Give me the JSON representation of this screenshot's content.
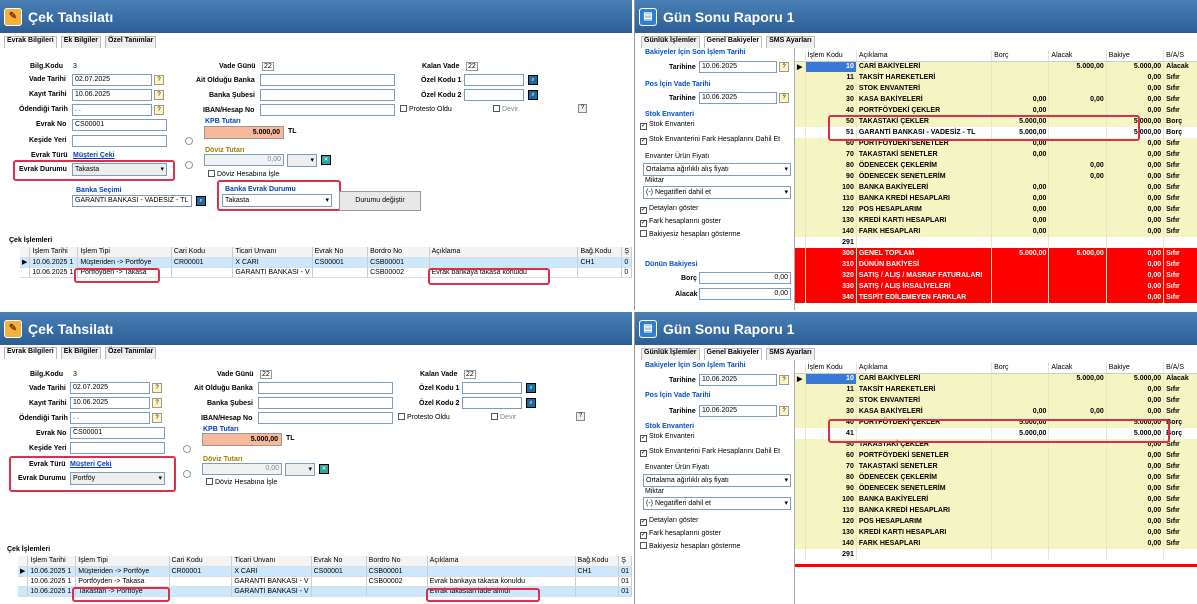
{
  "cek": {
    "title": "Çek Tahsilatı",
    "tabs": [
      "Evrak Bilgileri",
      "Ek Bilgiler",
      "Özel Tanımlar"
    ],
    "labels": {
      "bilg_kodu": "Bilg.Kodu",
      "vade_tarihi": "Vade Tarihi",
      "kayit_tarihi": "Kayıt Tarihi",
      "odendigi_tarih": "Ödendiği Tarih",
      "evrak_no": "Evrak No",
      "keside_yeri": "Keşide Yeri",
      "evrak_turu": "Evrak Türü",
      "evrak_durumu": "Evrak Durumu",
      "vade_gunu": "Vade Günü",
      "ait_oldugu_banka": "Ait Olduğu Banka",
      "banka_subesi": "Banka Şubesi",
      "iban": "IBAN/Hesap No",
      "kalan_vade": "Kalan Vade",
      "ozel_kodu_1": "Özel Kodu 1",
      "ozel_kodu_2": "Özel Kodu 2",
      "protesto": "Protesto Oldu",
      "devir": "Devir",
      "kpb_tutari": "KPB Tutarı",
      "doviz_tutari": "Döviz Tutarı",
      "doviz_hesabina": "Döviz Hesabına İşle",
      "banka_secimi": "Banka Seçimi",
      "banka_evrak_durumu": "Banka Evrak Durumu",
      "durumu_degistir": "Durumu değiştir",
      "cek_islemleri": "Çek İşlemleri",
      "tl": "TL",
      "q": "?",
      "badge": "22",
      "bilg_val": "3"
    },
    "values": {
      "vade_tarihi": "02.07.2025",
      "kayit_tarihi": "10.06.2025",
      "odendigi_tarih": " .  .",
      "evrak_no": "CS00001",
      "evrak_turu": "Müşteri Çeki",
      "kpb_tutari": "5.000,00",
      "doviz_tutari": "0,00",
      "banka": "GARANTİ BANKASI - VADESİZ - TL"
    },
    "top": {
      "evrak_durumu": "Takasta",
      "banka_evrak_durumu": "Takasta"
    },
    "bottom": {
      "evrak_durumu": "Portföy"
    },
    "grid_headers": [
      "İşlem Tarihi",
      "İşlem Tipi",
      "Cari Kodu",
      "Ticari Unvanı",
      "Evrak No",
      "Bordro No",
      "Açıklama",
      "Bağ.Kodu",
      "Ş"
    ],
    "top_rows": [
      [
        "10.06.2025 1",
        "Müşteriden -> Portföye",
        "CR00001",
        "X CARİ",
        "CS00001",
        "CSB00001",
        "",
        "CH1",
        "0"
      ],
      [
        "10.06.2025 1",
        "Portföyden -> Takasa",
        "",
        "GARANTİ BANKASI - V",
        "",
        "CSB00002",
        "Evrak bankaya takasa konuldu",
        "",
        "0"
      ]
    ],
    "bottom_rows": [
      [
        "10.06.2025 1",
        "Müşteriden -> Portföye",
        "CR00001",
        "X CARİ",
        "CS00001",
        "CSB00001",
        "",
        "CH1",
        "01"
      ],
      [
        "10.06.2025 1",
        "Portföyden -> Takasa",
        "",
        "GARANTİ BANKASI - V",
        "",
        "CSB00002",
        "Evrak bankaya takasa konuldu",
        "",
        "01"
      ],
      [
        "10.06.2025 1",
        "Takastan -> Portföye",
        "",
        "GARANTİ BANKASI - V",
        "",
        "",
        "Evrak takastan iade alındı",
        "",
        "01"
      ]
    ]
  },
  "gun": {
    "title": "Gün Sonu Raporu 1",
    "tabs": [
      "Günlük İşlemler",
      "Genel Bakiyeler",
      "SMS Ayarları"
    ],
    "left": {
      "bakiye_title": "Bakiyeler İçin Son İşlem Tarihi",
      "tarihine": "Tarihine",
      "tarih": "10.06.2025",
      "pos_title": "Pos İçin Vade Tarihi",
      "pos_tarih": "10.06.2025",
      "stok_title": "Stok Envanteri",
      "stok_envanteri": "Stok Envanteri",
      "stok_fark": "Stok Envanterini Fark Hesaplarını Dahil Et",
      "envanter_fiyat": "Envanter Ürün Fiyatı",
      "envanter_val": "Ortalama ağırlıklı alış fiyatı",
      "miktar": "Miktar",
      "miktar_val": "(-) Negatifleri dahil et",
      "detay": "Detayları göster",
      "fark": "Fark hesaplarını göster",
      "bakiyesiz": "Bakiyesiz hesapları gösterme",
      "dunun": "Dünün Bakiyesi",
      "borc": "Borç",
      "alacak": "Alacak",
      "zero": "0,00"
    },
    "headers": [
      "İşlem Kodu",
      "Açıklama",
      "Borç",
      "Alacak",
      "Bakiye",
      "B/A/S"
    ],
    "top_rows": [
      [
        "10",
        "CARİ BAKİYELERİ",
        "",
        "5.000,00",
        "5.000,00",
        "Alacak",
        "y"
      ],
      [
        "11",
        "TAKSİT HAREKETLERİ",
        "",
        "",
        "0,00",
        "Sıfır",
        "y"
      ],
      [
        "20",
        "STOK ENVANTERİ",
        "",
        "",
        "0,00",
        "Sıfır",
        "y"
      ],
      [
        "30",
        "KASA BAKİYELERİ",
        "0,00",
        "0,00",
        "0,00",
        "Sıfır",
        "y"
      ],
      [
        "40",
        "PORTFÖYDEKİ ÇEKLER",
        "0,00",
        "",
        "0,00",
        "Sıfır",
        "y"
      ],
      [
        "50",
        "TAKASTAKİ ÇEKLER",
        "5.000,00",
        "",
        "5.000,00",
        "Borç",
        "y"
      ],
      [
        "51",
        "GARANTİ BANKASI - VADESİZ - TL",
        "5.000,00",
        "",
        "5.000,00",
        "Borç",
        "w"
      ],
      [
        "60",
        "PORTFÖYDEKİ SENETLER",
        "0,00",
        "",
        "0,00",
        "Sıfır",
        "y"
      ],
      [
        "70",
        "TAKASTAKİ SENETLER",
        "0,00",
        "",
        "0,00",
        "Sıfır",
        "y"
      ],
      [
        "80",
        "ÖDENECEK ÇEKLERİM",
        "",
        "0,00",
        "0,00",
        "Sıfır",
        "y"
      ],
      [
        "90",
        "ÖDENECEK SENETLERİM",
        "",
        "0,00",
        "0,00",
        "Sıfır",
        "y"
      ],
      [
        "100",
        "BANKA BAKİYELERİ",
        "0,00",
        "",
        "0,00",
        "Sıfır",
        "y"
      ],
      [
        "110",
        "BANKA KREDİ HESAPLARI",
        "0,00",
        "",
        "0,00",
        "Sıfır",
        "y"
      ],
      [
        "120",
        "POS HESAPLARIM",
        "0,00",
        "",
        "0,00",
        "Sıfır",
        "y"
      ],
      [
        "130",
        "KREDİ KARTI HESAPLARI",
        "0,00",
        "",
        "0,00",
        "Sıfır",
        "y"
      ],
      [
        "140",
        "FARK HESAPLARI",
        "0,00",
        "",
        "0,00",
        "Sıfır",
        "y"
      ],
      [
        "291",
        "",
        "",
        "",
        "",
        "",
        "w"
      ],
      [
        "300",
        "GENEL TOPLAM",
        "5.000,00",
        "5.000,00",
        "0,00",
        "Sıfır",
        "r"
      ],
      [
        "310",
        "DÜNÜN BAKİYESİ",
        "",
        "",
        "0,00",
        "Sıfır",
        "r"
      ],
      [
        "320",
        "SATIŞ / ALIŞ / MASRAF FATURALARI",
        "",
        "",
        "0,00",
        "Sıfır",
        "r"
      ],
      [
        "330",
        "SATIŞ / ALIŞ İRSALİYELERİ",
        "",
        "",
        "0,00",
        "Sıfır",
        "r"
      ],
      [
        "340",
        "TESPİT EDİLEMEYEN FARKLAR",
        "",
        "",
        "0,00",
        "Sıfır",
        "r"
      ]
    ],
    "bottom_rows": [
      [
        "10",
        "CARİ BAKİYELERİ",
        "",
        "5.000,00",
        "5.000,00",
        "Alacak",
        "y"
      ],
      [
        "11",
        "TAKSİT HAREKETLERİ",
        "",
        "",
        "0,00",
        "Sıfır",
        "y"
      ],
      [
        "20",
        "STOK ENVANTERİ",
        "",
        "",
        "0,00",
        "Sıfır",
        "y"
      ],
      [
        "30",
        "KASA BAKİYELERİ",
        "0,00",
        "0,00",
        "0,00",
        "Sıfır",
        "y"
      ],
      [
        "40",
        "PORTFÖYDEKİ ÇEKLER",
        "5.000,00",
        "",
        "5.000,00",
        "Borç",
        "y"
      ],
      [
        "41",
        "",
        "5.000,00",
        "",
        "5.000,00",
        "Borç",
        "w"
      ],
      [
        "50",
        "TAKASTAKİ ÇEKLER",
        "",
        "",
        "0,00",
        "Sıfır",
        "y"
      ],
      [
        "60",
        "PORTFÖYDEKİ SENETLER",
        "",
        "",
        "0,00",
        "Sıfır",
        "y"
      ],
      [
        "70",
        "TAKASTAKİ SENETLER",
        "",
        "",
        "0,00",
        "Sıfır",
        "y"
      ],
      [
        "80",
        "ÖDENECEK ÇEKLERİM",
        "",
        "",
        "0,00",
        "Sıfır",
        "y"
      ],
      [
        "90",
        "ÖDENECEK SENETLERİM",
        "",
        "",
        "0,00",
        "Sıfır",
        "y"
      ],
      [
        "100",
        "BANKA BAKİYELERİ",
        "",
        "",
        "0,00",
        "Sıfır",
        "y"
      ],
      [
        "110",
        "BANKA KREDİ HESAPLARI",
        "",
        "",
        "0,00",
        "Sıfır",
        "y"
      ],
      [
        "120",
        "POS HESAPLARIM",
        "",
        "",
        "0,00",
        "Sıfır",
        "y"
      ],
      [
        "130",
        "KREDİ KARTI HESAPLARI",
        "",
        "",
        "0,00",
        "Sıfır",
        "y"
      ],
      [
        "140",
        "FARK HESAPLARI",
        "",
        "",
        "0,00",
        "Sıfır",
        "y"
      ],
      [
        "291",
        "",
        "",
        "",
        "",
        "",
        "w"
      ]
    ]
  },
  "colors": {
    "titlebar": "#2b5e96",
    "highlight": "#d9304c",
    "yellow_row": "#f5f5c4",
    "red_row": "#ff0000",
    "kpb": "#f8b89a"
  }
}
